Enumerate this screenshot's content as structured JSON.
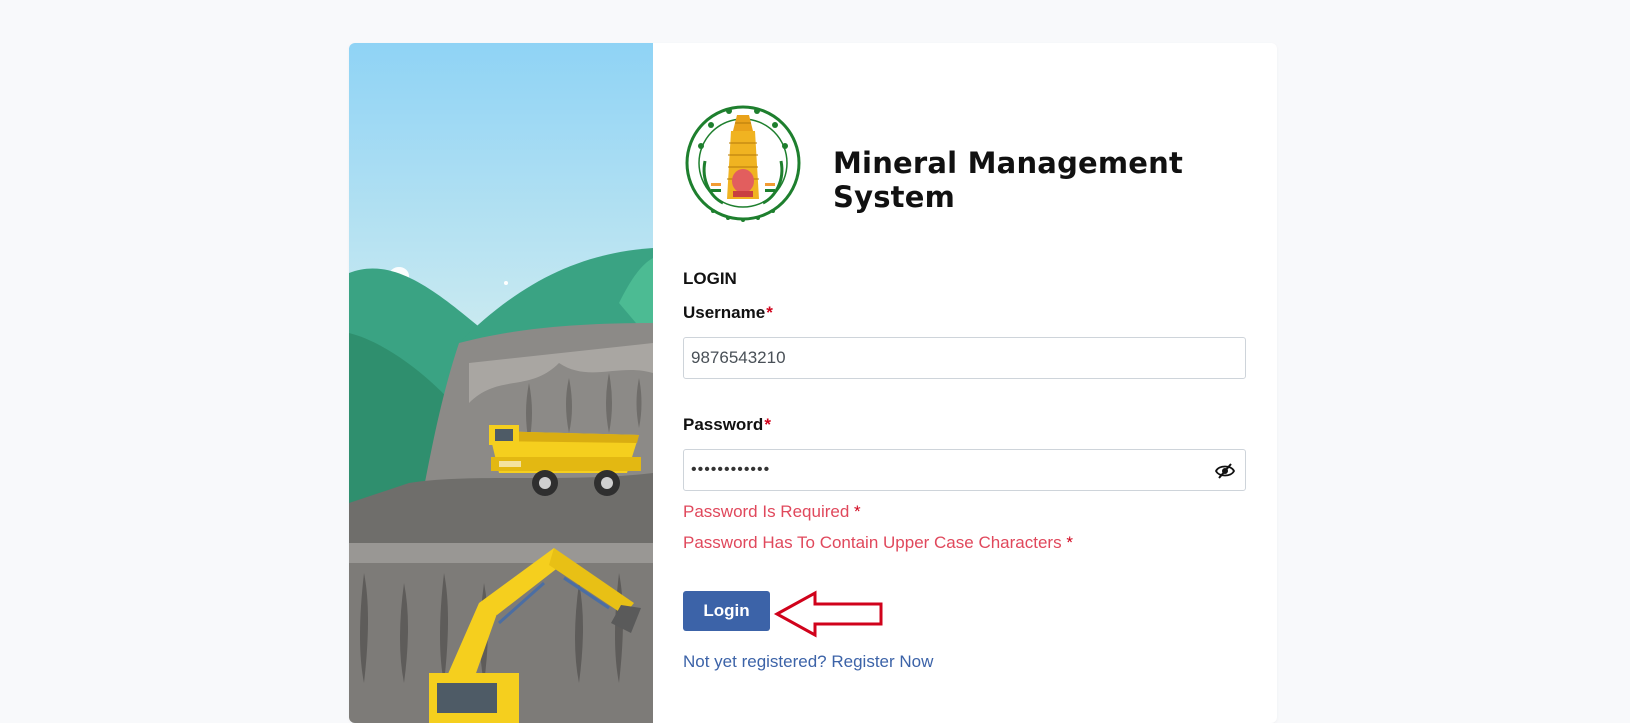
{
  "header": {
    "title": "Mineral Management System"
  },
  "emblem": {
    "label": "Tamil Nadu government emblem"
  },
  "login": {
    "heading": "LOGIN",
    "username_label": "Username",
    "username_value": "9876543210",
    "password_label": "Password",
    "password_value": "••••••••••••",
    "required_marker": "*",
    "errors": [
      "Password Is Required",
      "Password Has To Contain Upper Case Characters"
    ],
    "submit_label": "Login",
    "register_prompt": "Not yet registered?",
    "register_link": "Register Now"
  },
  "icons": {
    "toggle_password": "eye-off-icon",
    "annotation": "arrow-left-icon"
  },
  "colors": {
    "primary": "#3c63a8",
    "error": "#e0485c",
    "required": "#d0021b",
    "annotation": "#d0021b",
    "page_bg": "#f8f9fb"
  }
}
